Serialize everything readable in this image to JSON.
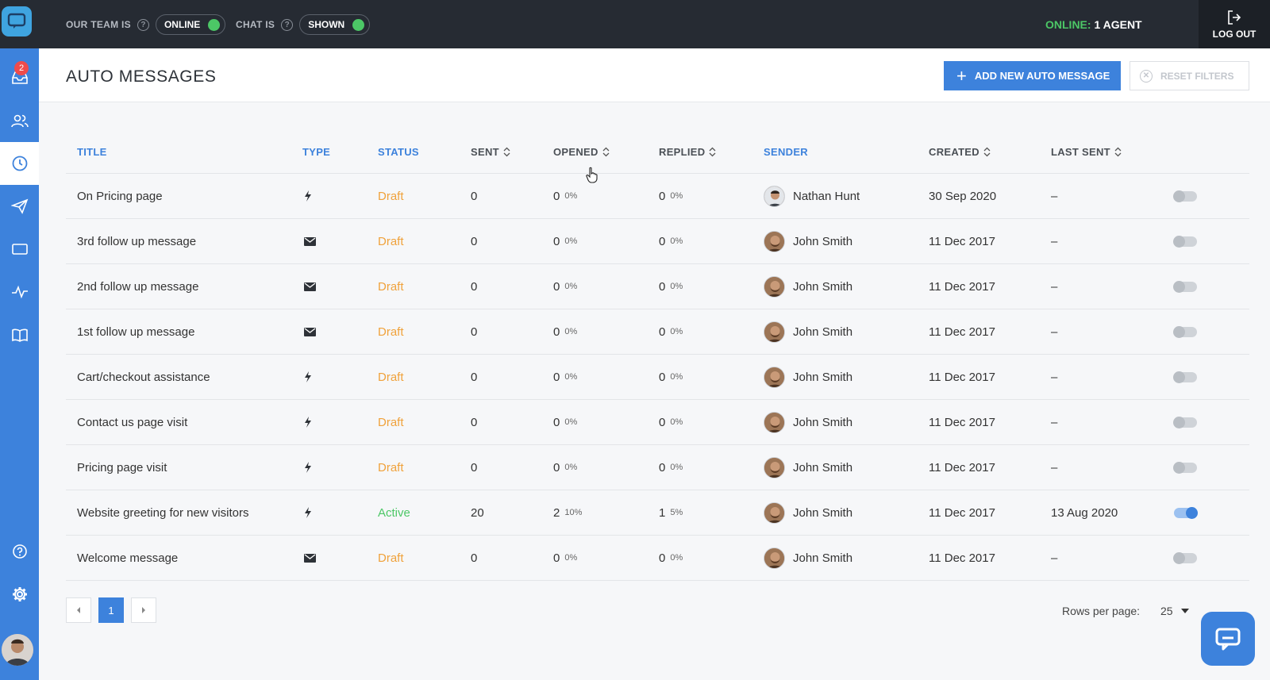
{
  "topbar": {
    "team_label": "OUR TEAM IS",
    "team_state": "ONLINE",
    "chat_label": "CHAT IS",
    "chat_state": "SHOWN",
    "online_prefix": "ONLINE:",
    "online_value": "1 AGENT",
    "logout_label": "LOG OUT"
  },
  "sidebar": {
    "inbox_badge": "2",
    "items": [
      "inbox",
      "contacts",
      "auto-messages",
      "campaigns",
      "widget",
      "activity",
      "knowledge-base",
      "help",
      "settings"
    ]
  },
  "header": {
    "title": "AUTO MESSAGES",
    "add_button": "ADD NEW AUTO MESSAGE",
    "reset_button": "RESET FILTERS"
  },
  "table": {
    "columns": {
      "title": "TITLE",
      "type": "TYPE",
      "status": "STATUS",
      "sent": "SENT",
      "opened": "OPENED",
      "replied": "REPLIED",
      "sender": "SENDER",
      "created": "CREATED",
      "last_sent": "LAST SENT"
    },
    "rows": [
      {
        "title": "On Pricing page",
        "type": "trigger",
        "status": "Draft",
        "sent": "0",
        "opened": "0",
        "opened_pct": "0%",
        "replied": "0",
        "replied_pct": "0%",
        "sender": "Nathan Hunt",
        "created": "30 Sep 2020",
        "last_sent": "–",
        "enabled": false
      },
      {
        "title": "3rd follow up message",
        "type": "email",
        "status": "Draft",
        "sent": "0",
        "opened": "0",
        "opened_pct": "0%",
        "replied": "0",
        "replied_pct": "0%",
        "sender": "John Smith",
        "created": "11 Dec 2017",
        "last_sent": "–",
        "enabled": false
      },
      {
        "title": "2nd follow up message",
        "type": "email",
        "status": "Draft",
        "sent": "0",
        "opened": "0",
        "opened_pct": "0%",
        "replied": "0",
        "replied_pct": "0%",
        "sender": "John Smith",
        "created": "11 Dec 2017",
        "last_sent": "–",
        "enabled": false
      },
      {
        "title": "1st follow up message",
        "type": "email",
        "status": "Draft",
        "sent": "0",
        "opened": "0",
        "opened_pct": "0%",
        "replied": "0",
        "replied_pct": "0%",
        "sender": "John Smith",
        "created": "11 Dec 2017",
        "last_sent": "–",
        "enabled": false
      },
      {
        "title": "Cart/checkout assistance",
        "type": "trigger",
        "status": "Draft",
        "sent": "0",
        "opened": "0",
        "opened_pct": "0%",
        "replied": "0",
        "replied_pct": "0%",
        "sender": "John Smith",
        "created": "11 Dec 2017",
        "last_sent": "–",
        "enabled": false
      },
      {
        "title": "Contact us page visit",
        "type": "trigger",
        "status": "Draft",
        "sent": "0",
        "opened": "0",
        "opened_pct": "0%",
        "replied": "0",
        "replied_pct": "0%",
        "sender": "John Smith",
        "created": "11 Dec 2017",
        "last_sent": "–",
        "enabled": false
      },
      {
        "title": "Pricing page visit",
        "type": "trigger",
        "status": "Draft",
        "sent": "0",
        "opened": "0",
        "opened_pct": "0%",
        "replied": "0",
        "replied_pct": "0%",
        "sender": "John Smith",
        "created": "11 Dec 2017",
        "last_sent": "–",
        "enabled": false
      },
      {
        "title": "Website greeting for new visitors",
        "type": "trigger",
        "status": "Active",
        "sent": "20",
        "opened": "2",
        "opened_pct": "10%",
        "replied": "1",
        "replied_pct": "5%",
        "sender": "John Smith",
        "created": "11 Dec 2017",
        "last_sent": "13 Aug 2020",
        "enabled": true
      },
      {
        "title": "Welcome message",
        "type": "email",
        "status": "Draft",
        "sent": "0",
        "opened": "0",
        "opened_pct": "0%",
        "replied": "0",
        "replied_pct": "0%",
        "sender": "John Smith",
        "created": "11 Dec 2017",
        "last_sent": "–",
        "enabled": false
      }
    ]
  },
  "pagination": {
    "current_page": "1",
    "rows_per_page_label": "Rows per page:",
    "rows_per_page_value": "25"
  },
  "colors": {
    "accent": "#3d82dc",
    "topbar": "#262b33",
    "draft": "#f0a23b",
    "active": "#4cc766"
  }
}
